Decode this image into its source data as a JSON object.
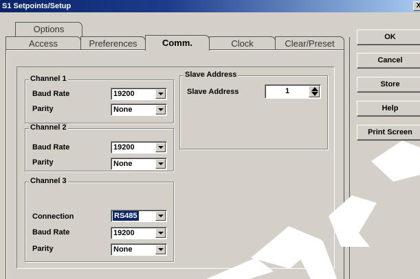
{
  "window": {
    "title": "S1 Setpoints/Setup",
    "close_label": "X"
  },
  "tabs": {
    "row1": [
      {
        "label": "Options"
      }
    ],
    "row2": [
      {
        "label": "Access"
      },
      {
        "label": "Preferences"
      },
      {
        "label": "Comm.",
        "active": true
      },
      {
        "label": "Clock"
      },
      {
        "label": "Clear/Preset"
      }
    ]
  },
  "channel1": {
    "legend": "Channel 1",
    "baud_rate_label": "Baud Rate",
    "baud_rate_value": "19200",
    "parity_label": "Parity",
    "parity_value": "None"
  },
  "channel2": {
    "legend": "Channel 2",
    "baud_rate_label": "Baud Rate",
    "baud_rate_value": "19200",
    "parity_label": "Parity",
    "parity_value": "None"
  },
  "channel3": {
    "legend": "Channel 3",
    "connection_label": "Connection",
    "connection_value": "RS485",
    "baud_rate_label": "Baud Rate",
    "baud_rate_value": "19200",
    "parity_label": "Parity",
    "parity_value": "None"
  },
  "slave": {
    "legend": "Slave Address",
    "label": "Slave Address",
    "value": "1"
  },
  "buttons": {
    "ok": "OK",
    "cancel": "Cancel",
    "store": "Store",
    "help": "Help",
    "print_screen": "Print Screen"
  },
  "colors": {
    "window_bg": "#d4d0c8",
    "titlebar": "#0a246a",
    "selection": "#0a246a"
  }
}
